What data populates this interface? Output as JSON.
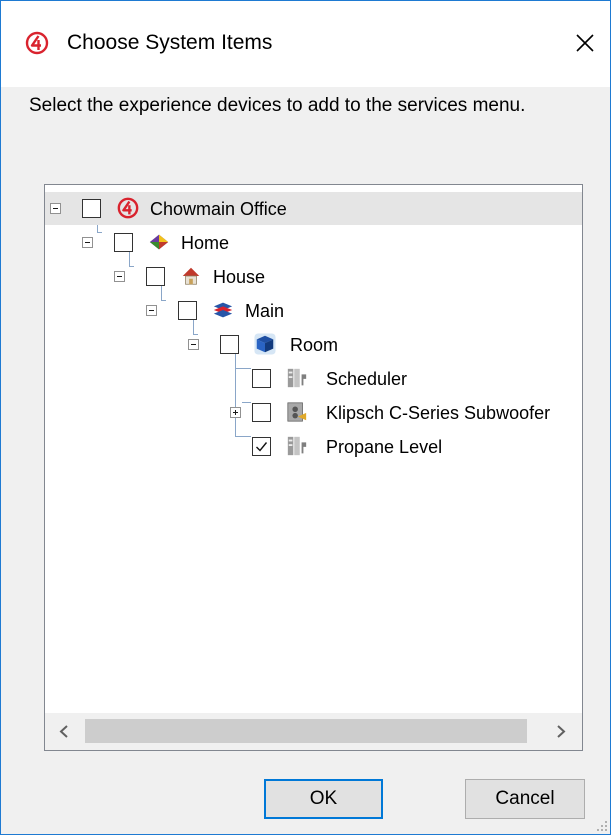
{
  "window": {
    "title": "Choose System Items",
    "close_icon": "close-icon",
    "app_icon": "control4-logo-icon"
  },
  "instruction": "Select the experience devices to add to the services menu.",
  "tree": {
    "nodes": [
      {
        "label": "Chowmain Office",
        "checked": false,
        "icon": "control4-logo-icon",
        "expander": "minus",
        "selected": true
      },
      {
        "label": "Home",
        "checked": false,
        "icon": "home-icon",
        "expander": "minus"
      },
      {
        "label": "House",
        "checked": false,
        "icon": "house-icon",
        "expander": "minus"
      },
      {
        "label": "Main",
        "checked": false,
        "icon": "floor-icon",
        "expander": "minus"
      },
      {
        "label": "Room",
        "checked": false,
        "icon": "room-icon",
        "expander": "minus"
      },
      {
        "label": "Scheduler",
        "checked": false,
        "icon": "driver-icon",
        "expander": "none"
      },
      {
        "label": "Klipsch C-Series Subwoofer",
        "checked": false,
        "icon": "subwoofer-icon",
        "expander": "plus"
      },
      {
        "label": "Propane Level",
        "checked": true,
        "icon": "driver-icon",
        "expander": "none"
      }
    ]
  },
  "buttons": {
    "ok": "OK",
    "cancel": "Cancel"
  },
  "colors": {
    "accent": "#0078d7",
    "window_border": "#1e7ad2",
    "logo_red": "#d9232e",
    "selection": "#e5e5e5"
  }
}
